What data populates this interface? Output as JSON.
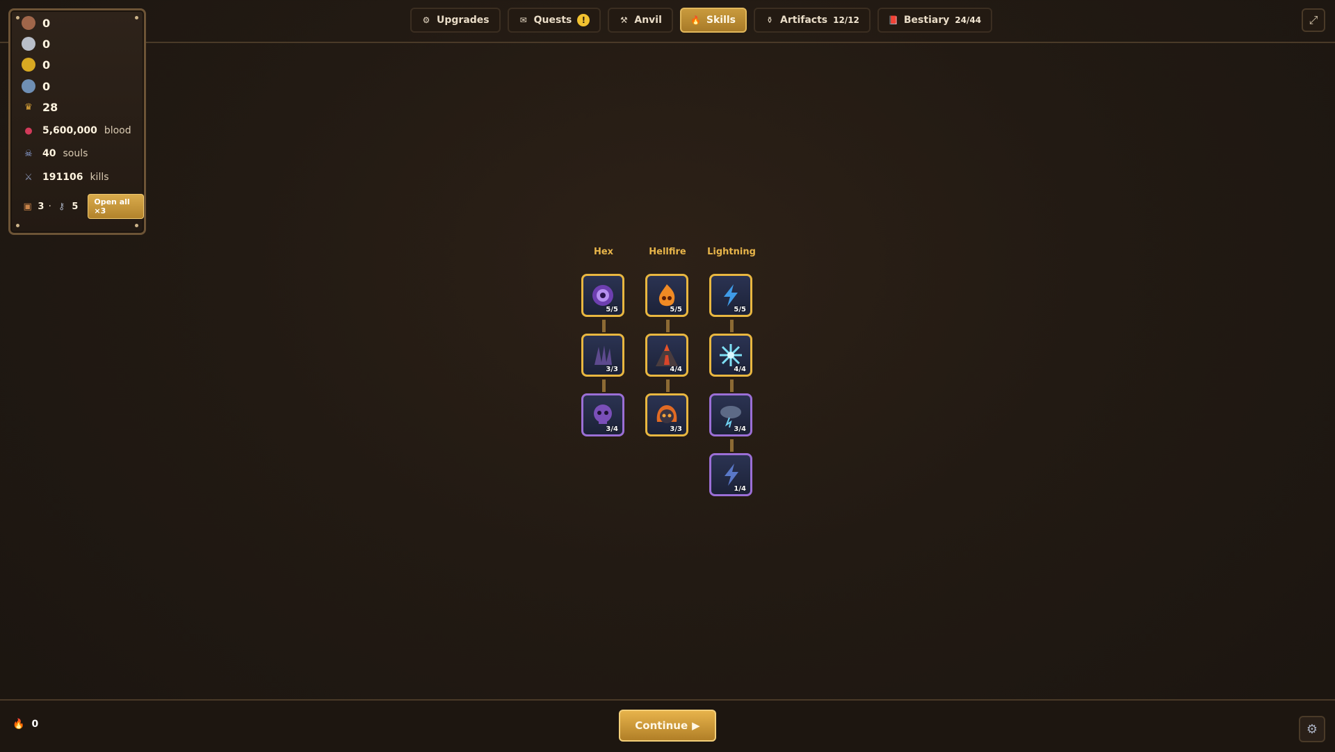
{
  "nav": {
    "tabs": [
      {
        "label": "Upgrades",
        "icon": "gear-icon"
      },
      {
        "label": "Quests",
        "icon": "scroll-icon",
        "alert": "!"
      },
      {
        "label": "Anvil",
        "icon": "anvil-icon"
      },
      {
        "label": "Skills",
        "icon": "flame-icon",
        "active": true
      },
      {
        "label": "Artifacts",
        "icon": "artifact-icon",
        "count": "12/12"
      },
      {
        "label": "Bestiary",
        "icon": "book-icon",
        "count": "24/44"
      }
    ]
  },
  "resources": {
    "copper": "0",
    "silver": "0",
    "gold": "0",
    "gem": "0",
    "crowns": "28",
    "blood": {
      "value": "5,600,000",
      "label": "blood"
    },
    "souls": {
      "value": "40",
      "label": "souls"
    },
    "kills": {
      "value": "191106",
      "label": "kills"
    },
    "chests": "3",
    "separator": "·",
    "keys": "5",
    "open_all_label": "Open all ×3"
  },
  "skills": {
    "columns": [
      {
        "name": "Hex",
        "nodes": [
          {
            "icon": "hex-eye-icon",
            "level": "5/5",
            "complete": true
          },
          {
            "icon": "shadow-claw-icon",
            "level": "3/3",
            "complete": true
          },
          {
            "icon": "cursed-skull-icon",
            "level": "3/4",
            "complete": false
          }
        ]
      },
      {
        "name": "Hellfire",
        "nodes": [
          {
            "icon": "fire-skull-icon",
            "level": "5/5",
            "complete": true
          },
          {
            "icon": "volcano-icon",
            "level": "4/4",
            "complete": true
          },
          {
            "icon": "flame-demon-icon",
            "level": "3/3",
            "complete": true
          }
        ]
      },
      {
        "name": "Lightning",
        "nodes": [
          {
            "icon": "lightning-bolt-icon",
            "level": "5/5",
            "complete": true
          },
          {
            "icon": "frost-burst-icon",
            "level": "4/4",
            "complete": true
          },
          {
            "icon": "storm-cloud-icon",
            "level": "3/4",
            "complete": false
          },
          {
            "icon": "charged-bolt-icon",
            "level": "1/4",
            "complete": false
          }
        ]
      }
    ]
  },
  "bottom": {
    "flame_count": "0",
    "continue_label": "Continue"
  },
  "colors": {
    "accent_gold": "#e9b740",
    "partial_purple": "#9b6fd6",
    "title_gold": "#e8b54a"
  }
}
